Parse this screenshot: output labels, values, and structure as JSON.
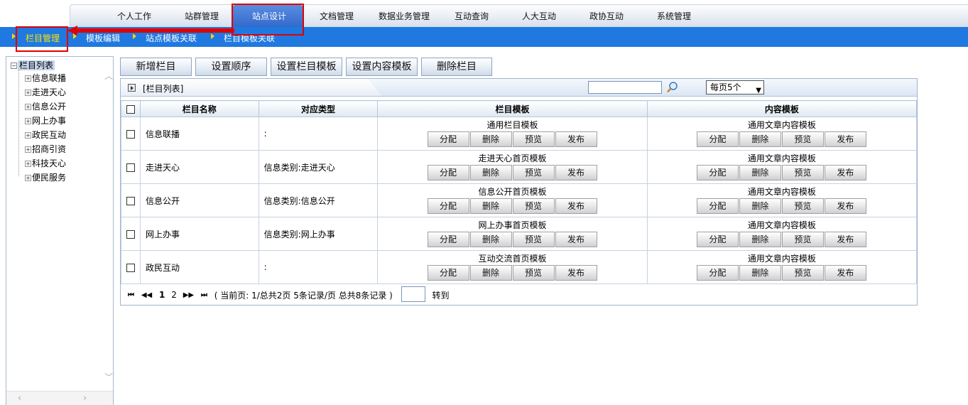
{
  "top_nav": {
    "items": [
      "个人工作",
      "站群管理",
      "站点设计",
      "文档管理",
      "数据业务管理",
      "互动查询",
      "人大互动",
      "政协互动",
      "系统管理"
    ],
    "active": "站点设计"
  },
  "sub_nav": {
    "items": [
      "栏目管理",
      "模板编辑",
      "站点模板关联",
      "栏目模板关联"
    ],
    "active": "栏目管理"
  },
  "sidebar": {
    "root": "栏目列表",
    "items": [
      "信息联播",
      "走进天心",
      "信息公开",
      "网上办事",
      "政民互动",
      "招商引资",
      "科技天心",
      "便民服务"
    ]
  },
  "toolbar": {
    "add": "新增栏目",
    "order": "设置顺序",
    "column_tpl": "设置栏目模板",
    "content_tpl": "设置内容模板",
    "delete": "删除栏目"
  },
  "panel": {
    "title": "[栏目列表]",
    "search_value": "",
    "page_size_option": "每页5个"
  },
  "grid": {
    "headers": [
      "栏目名称",
      "对应类型",
      "栏目模板",
      "内容模板"
    ],
    "action_labels": [
      "分配",
      "删除",
      "预览",
      "发布"
    ],
    "rows": [
      {
        "name": "信息联播",
        "type": ":",
        "column_template": "通用栏目模板",
        "content_template": "通用文章内容模板"
      },
      {
        "name": "走进天心",
        "type": "信息类别:走进天心",
        "column_template": "走进天心首页模板",
        "content_template": "通用文章内容模板"
      },
      {
        "name": "信息公开",
        "type": "信息类别:信息公开",
        "column_template": "信息公开首页模板",
        "content_template": "通用文章内容模板"
      },
      {
        "name": "网上办事",
        "type": "信息类别:网上办事",
        "column_template": "网上办事首页模板",
        "content_template": "通用文章内容模板"
      },
      {
        "name": "政民互动",
        "type": ":",
        "column_template": "互动交流首页模板",
        "content_template": "通用文章内容模板"
      }
    ]
  },
  "pager": {
    "first": "⏮",
    "prev": "◀◀",
    "pages": [
      "1",
      "2"
    ],
    "next": "▶▶",
    "last": "⏭",
    "info": "( 当前页: 1/总共2页 5条记录/页 总共8条记录 )",
    "goto_label": "转到"
  },
  "colors": {
    "accent_blue": "#1f79e0",
    "highlight_red": "#e00000",
    "active_sub": "#ffe300"
  }
}
